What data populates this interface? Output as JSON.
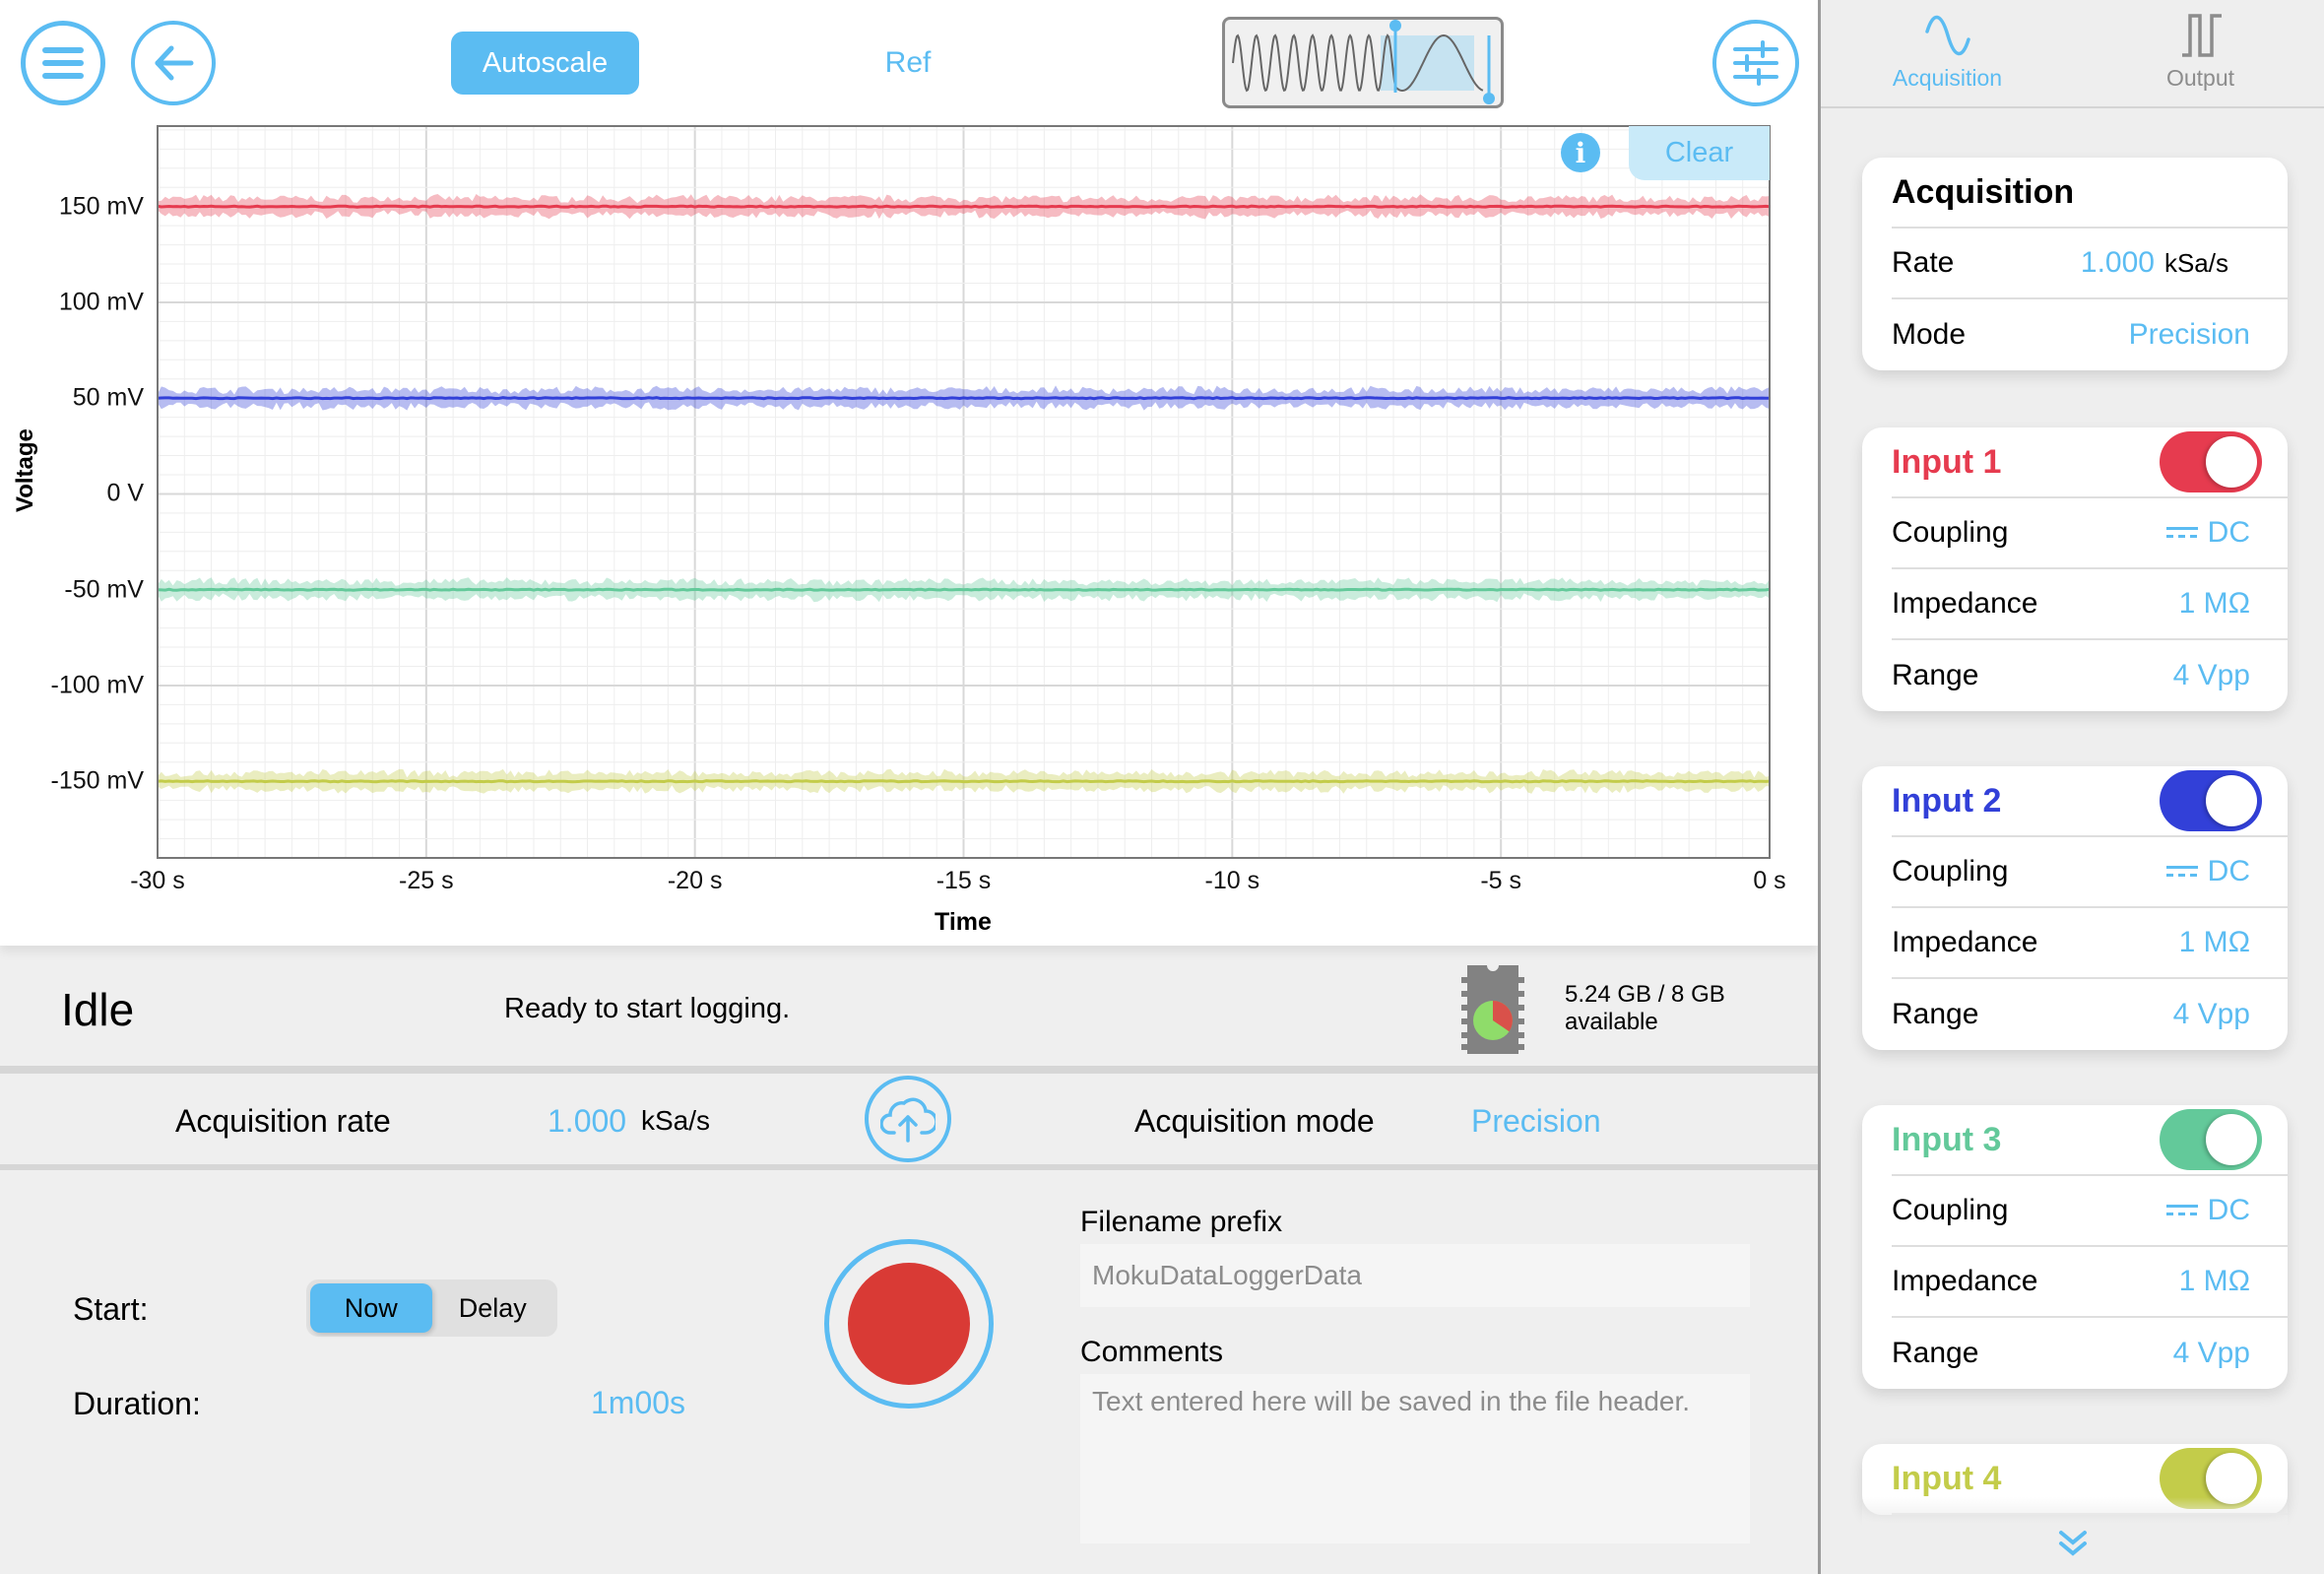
{
  "toolbar": {
    "menu_icon": "hamburger-menu-icon",
    "back_icon": "arrow-left-icon",
    "autoscale_label": "Autoscale",
    "ref_label": "Ref",
    "overview_icon": "waveform-zoom-overview-icon",
    "settings_icon": "sliders-icon"
  },
  "chart": {
    "info_icon": "info-icon",
    "clear_label": "Clear"
  },
  "chart_data": {
    "type": "line",
    "title": "",
    "xlabel": "Time",
    "ylabel": "Voltage",
    "xlim": [
      -30,
      0
    ],
    "ylim": [
      -190,
      192
    ],
    "x_unit": "s",
    "y_unit": "mV",
    "grid": true,
    "x_ticks": [
      -30,
      -25,
      -20,
      -15,
      -10,
      -5,
      0
    ],
    "x_tick_labels": [
      "-30 s",
      "-25 s",
      "-20 s",
      "-15 s",
      "-10 s",
      "-5 s",
      "0 s"
    ],
    "y_ticks": [
      150,
      100,
      50,
      0,
      -50,
      -100,
      -150
    ],
    "y_tick_labels": [
      "150 mV",
      "100 mV",
      "50 mV",
      "0 V",
      "-50 mV",
      "-100 mV",
      "-150 mV"
    ],
    "series": [
      {
        "name": "Input 1",
        "color": "#e63b4f",
        "level_mV": 150,
        "noise_mV": 4
      },
      {
        "name": "Input 2",
        "color": "#3240d8",
        "level_mV": 50,
        "noise_mV": 4
      },
      {
        "name": "Input 3",
        "color": "#63c99a",
        "level_mV": -50,
        "noise_mV": 4
      },
      {
        "name": "Input 4",
        "color": "#c3cc4a",
        "level_mV": -150,
        "noise_mV": 4
      }
    ]
  },
  "status": {
    "state": "Idle",
    "message": "Ready to start logging.",
    "storage_icon": "memory-chip-pie-icon",
    "storage_used_fraction": 0.345,
    "storage_line1": "5.24 GB / 8 GB",
    "storage_line2": "available"
  },
  "acquisition_bar": {
    "rate_label": "Acquisition rate",
    "rate_value": "1.000",
    "rate_unit": "kSa/s",
    "upload_icon": "cloud-upload-icon",
    "mode_label": "Acquisition mode",
    "mode_value": "Precision"
  },
  "logging": {
    "start_label": "Start:",
    "start_options": [
      "Now",
      "Delay"
    ],
    "start_selected": "Now",
    "duration_label": "Duration:",
    "duration_value": "1m00s",
    "record_icon": "record-icon",
    "filename_label": "Filename prefix",
    "filename_value": "",
    "filename_placeholder": "MokuDataLoggerData",
    "comments_label": "Comments",
    "comments_value": "",
    "comments_placeholder": "Text entered here will be saved in the file header."
  },
  "sidebar": {
    "tabs": [
      {
        "label": "Acquisition",
        "icon": "sine-wave-icon",
        "active": true
      },
      {
        "label": "Output",
        "icon": "pulse-wave-icon",
        "active": false
      }
    ],
    "acquisition_card": {
      "title": "Acquisition",
      "rate_label": "Rate",
      "rate_value": "1.000",
      "rate_unit": "kSa/s",
      "mode_label": "Mode",
      "mode_value": "Precision"
    },
    "inputs": [
      {
        "title": "Input 1",
        "color": "#e63b4f",
        "enabled": true,
        "coupling_label": "Coupling",
        "coupling": "DC",
        "impedance_label": "Impedance",
        "impedance": "1 MΩ",
        "range_label": "Range",
        "range": "4 Vpp"
      },
      {
        "title": "Input 2",
        "color": "#3240d8",
        "enabled": true,
        "coupling_label": "Coupling",
        "coupling": "DC",
        "impedance_label": "Impedance",
        "impedance": "1 MΩ",
        "range_label": "Range",
        "range": "4 Vpp"
      },
      {
        "title": "Input 3",
        "color": "#63c99a",
        "enabled": true,
        "coupling_label": "Coupling",
        "coupling": "DC",
        "impedance_label": "Impedance",
        "impedance": "1 MΩ",
        "range_label": "Range",
        "range": "4 Vpp"
      },
      {
        "title": "Input 4",
        "color": "#c3cc4a",
        "enabled": true
      }
    ],
    "more_icon": "double-chevron-down-icon"
  },
  "colors": {
    "accent": "#5bbcf2",
    "record": "#d93a35"
  }
}
